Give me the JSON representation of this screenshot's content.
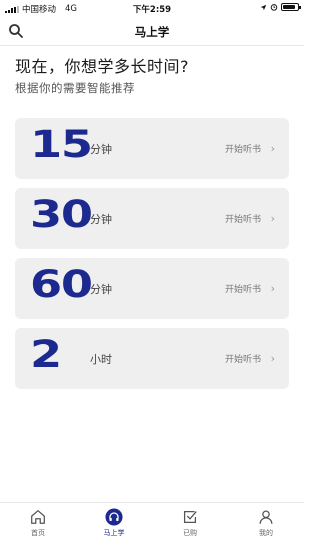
{
  "status_bar": {
    "carrier": "中国移动",
    "network": "4G",
    "time": "下午2:59"
  },
  "nav": {
    "title": "马上学",
    "search_icon": "search-icon"
  },
  "heading": "现在，你想学多长时间?",
  "subheading": "根据你的需要智能推荐",
  "cards": [
    {
      "number": "15",
      "unit": "分钟",
      "action": "开始听书"
    },
    {
      "number": "30",
      "unit": "分钟",
      "action": "开始听书"
    },
    {
      "number": "60",
      "unit": "分钟",
      "action": "开始听书"
    },
    {
      "number": "2",
      "unit": "小时",
      "action": "开始听书"
    }
  ],
  "tabs": [
    {
      "label": "首页",
      "icon": "home-icon"
    },
    {
      "label": "马上学",
      "icon": "headphones-icon"
    },
    {
      "label": "已购",
      "icon": "checkbox-icon"
    },
    {
      "label": "我的",
      "icon": "person-icon"
    }
  ],
  "colors": {
    "accent": "#1c2a8f",
    "card_bg": "#efefef"
  }
}
